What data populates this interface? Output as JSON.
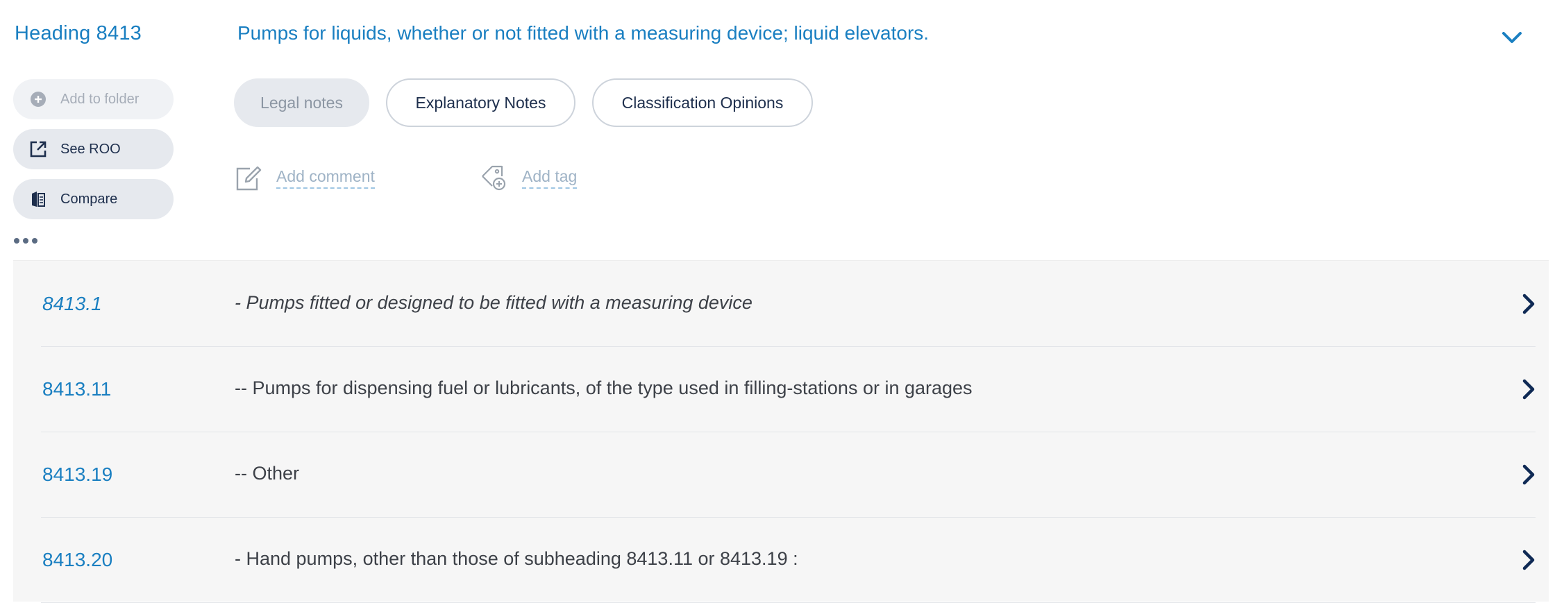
{
  "heading": {
    "label": "Heading 8413",
    "title": "Pumps for liquids, whether or not fitted with a measuring device; liquid elevators.",
    "toggle_icon": "chevron-down-icon"
  },
  "actions": {
    "add_to_folder": {
      "label": "Add to folder",
      "icon": "plus-circle-icon",
      "enabled": false
    },
    "see_roo": {
      "label": "See ROO",
      "icon": "external-link-icon"
    },
    "compare": {
      "label": "Compare",
      "icon": "compare-icon"
    }
  },
  "notes_tabs": [
    {
      "label": "Legal notes",
      "enabled": false
    },
    {
      "label": "Explanatory Notes"
    },
    {
      "label": "Classification Opinions"
    }
  ],
  "annotations": {
    "comment_label": "Add comment",
    "tag_label": "Add tag"
  },
  "subheadings": [
    {
      "code": "8413.1",
      "description": "- Pumps fitted or designed to be fitted with a measuring device",
      "italic": true
    },
    {
      "code": "8413.11",
      "description": "-- Pumps for dispensing fuel or lubricants, of the type used in filling-stations or in garages",
      "italic": false
    },
    {
      "code": "8413.19",
      "description": "-- Other",
      "italic": false
    },
    {
      "code": "8413.20",
      "description": "- Hand pumps, other than those of subheading 8413.11 or 8413.19 :",
      "italic": false
    }
  ],
  "colors": {
    "link_blue": "#1a7fc1",
    "navy": "#1e2f4d",
    "muted": "#9fb3c6",
    "row_bg": "#f6f6f6"
  }
}
